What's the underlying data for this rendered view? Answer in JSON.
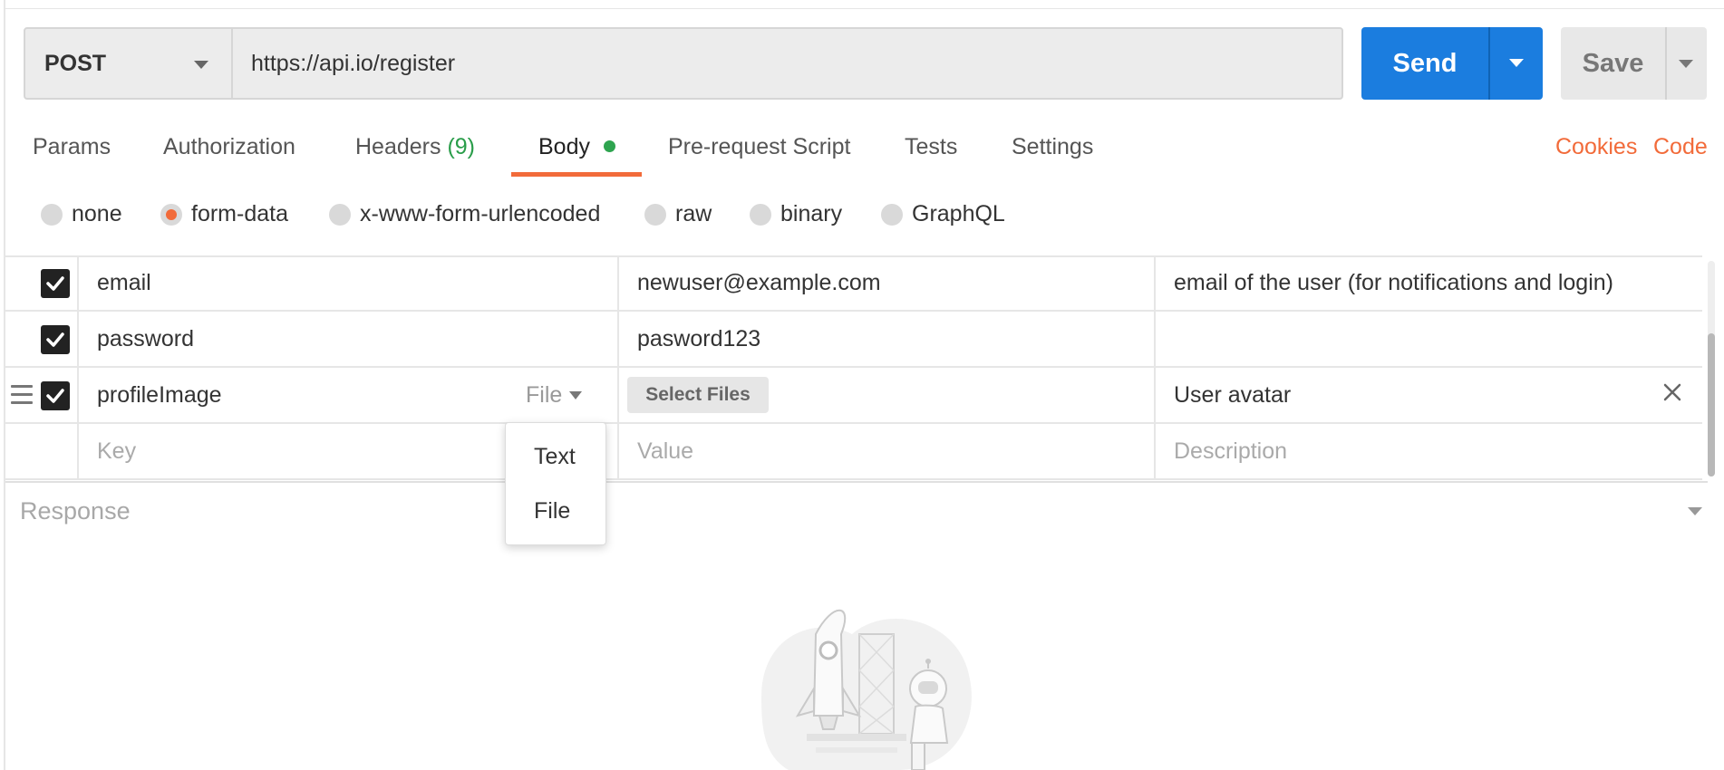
{
  "request": {
    "method": "POST",
    "url": "https://api.io/register",
    "send_label": "Send",
    "save_label": "Save"
  },
  "tabs": [
    {
      "label": "Params"
    },
    {
      "label": "Authorization"
    },
    {
      "label": "Headers",
      "count": "(9)"
    },
    {
      "label": "Body",
      "active": true,
      "indicator": "green-dot"
    },
    {
      "label": "Pre-request Script"
    },
    {
      "label": "Tests"
    },
    {
      "label": "Settings"
    }
  ],
  "links": {
    "cookies": "Cookies",
    "code": "Code"
  },
  "body_types": [
    {
      "label": "none",
      "selected": false
    },
    {
      "label": "form-data",
      "selected": true
    },
    {
      "label": "x-www-form-urlencoded",
      "selected": false
    },
    {
      "label": "raw",
      "selected": false
    },
    {
      "label": "binary",
      "selected": false
    },
    {
      "label": "GraphQL",
      "selected": false
    }
  ],
  "form_rows": [
    {
      "checked": true,
      "key": "email",
      "value": "newuser@example.com",
      "description": "email of the user (for notifications and login)"
    },
    {
      "checked": true,
      "key": "password",
      "value": "pasword123",
      "description": ""
    },
    {
      "checked": true,
      "key": "profileImage",
      "type": "File",
      "value_button": "Select Files",
      "description": "User avatar"
    }
  ],
  "placeholders": {
    "key": "Key",
    "value": "Value",
    "description": "Description"
  },
  "type_menu": [
    "Text",
    "File"
  ],
  "response_label": "Response",
  "colors": {
    "accent": "#f26b3a",
    "send_blue": "#1b7ddf",
    "count_green": "#2a9d4a"
  }
}
